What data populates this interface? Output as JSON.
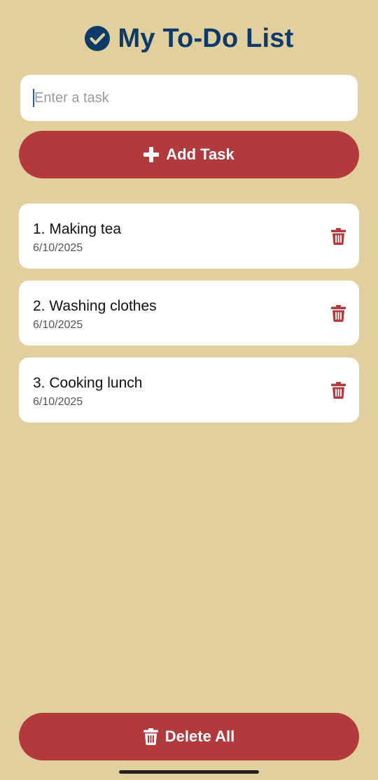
{
  "header": {
    "title": "My To-Do List",
    "icon": "check-circle-icon",
    "title_color": "#0D3A68"
  },
  "input": {
    "placeholder": "Enter a task",
    "value": ""
  },
  "add_button": {
    "label": "Add Task",
    "icon": "plus-icon"
  },
  "tasks": [
    {
      "title": "1. Making tea",
      "date": "6/10/2025"
    },
    {
      "title": "2. Washing clothes",
      "date": "6/10/2025"
    },
    {
      "title": "3. Cooking lunch",
      "date": "6/10/2025"
    }
  ],
  "delete_all_button": {
    "label": "Delete All",
    "icon": "trash-icon"
  },
  "colors": {
    "background": "#E1CF9D",
    "accent": "#B23A3C",
    "card": "#FFFFFF"
  }
}
